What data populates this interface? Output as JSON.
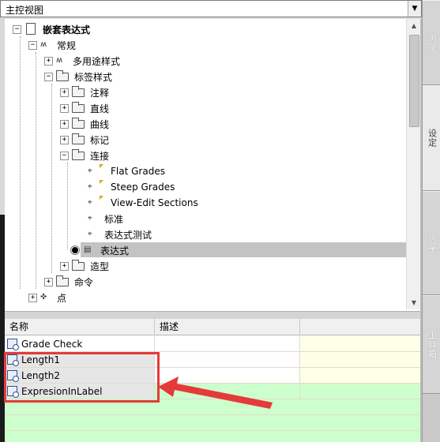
{
  "view_select": {
    "value": "主控视图"
  },
  "tree": {
    "root": "嵌套表达式",
    "general": "常规",
    "multipurpose": "多用途样式",
    "label_styles": "标签样式",
    "note": "注释",
    "line": "直线",
    "curve": "曲线",
    "marker": "标记",
    "link": "连接",
    "flat_grades": "Flat Grades",
    "steep_grades": "Steep Grades",
    "view_edit": "View-Edit Sections",
    "standard": "标准",
    "expr_test": "表达式测试",
    "expressions": "表达式",
    "modeling": "造型",
    "commands": "命令",
    "points": "点"
  },
  "grid": {
    "headers": [
      "名称",
      "描述",
      ""
    ],
    "rows": [
      {
        "name": "Grade Check"
      },
      {
        "name": "Length1"
      },
      {
        "name": "Length2"
      },
      {
        "name": "ExpresionInLabel"
      }
    ]
  },
  "tabs": [
    "浏览",
    "设定",
    "测量",
    "工具箱"
  ],
  "colors": {
    "highlight": "#e53a3a",
    "selection": "#c3c3c3",
    "green_row": "#ccffcc",
    "yellow_col": "#ffffe6"
  }
}
